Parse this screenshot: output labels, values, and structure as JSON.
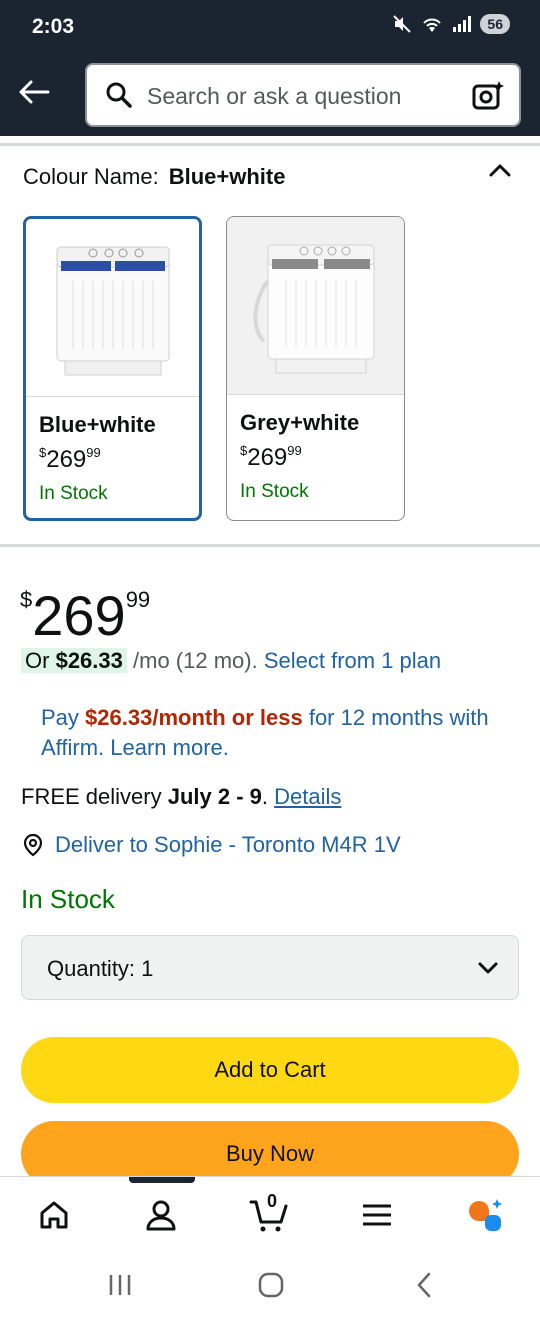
{
  "status_bar": {
    "time": "2:03",
    "battery": "56"
  },
  "search": {
    "placeholder": "Search or ask a question"
  },
  "colour": {
    "label": "Colour Name:",
    "selected": "Blue+white",
    "options": [
      {
        "name": "Blue+white",
        "price_whole": "269",
        "price_fraction": "99",
        "currency": "$",
        "stock": "In Stock"
      },
      {
        "name": "Grey+white",
        "price_whole": "269",
        "price_fraction": "99",
        "currency": "$",
        "stock": "In Stock"
      }
    ]
  },
  "price": {
    "currency": "$",
    "whole": "269",
    "fraction": "99"
  },
  "plan": {
    "or_text": "Or",
    "monthly": "$26.33",
    "term": "/mo (12 mo).",
    "link": "Select from 1 plan"
  },
  "affirm": {
    "pre": "Pay",
    "amount": "$26.33/month or less",
    "post": "for 12 months with Affirm. Learn more."
  },
  "delivery": {
    "pre": "FREE delivery",
    "dates": "July 2 - 9",
    "sep": ".",
    "link": "Details"
  },
  "deliver_to": "Deliver to Sophie - Toronto M4R 1V",
  "availability": "In Stock",
  "quantity": {
    "label": "Quantity:",
    "value": "1"
  },
  "buttons": {
    "add_to_cart": "Add to Cart",
    "buy_now": "Buy Now"
  },
  "bottom_nav": {
    "cart_count": "0"
  },
  "colors": {
    "header_bg": "#1b2431",
    "link": "#2162a1",
    "stock_green": "#007600",
    "price_red": "#b12704",
    "cart_yellow": "#ffd814",
    "buy_orange": "#ffa41c"
  }
}
